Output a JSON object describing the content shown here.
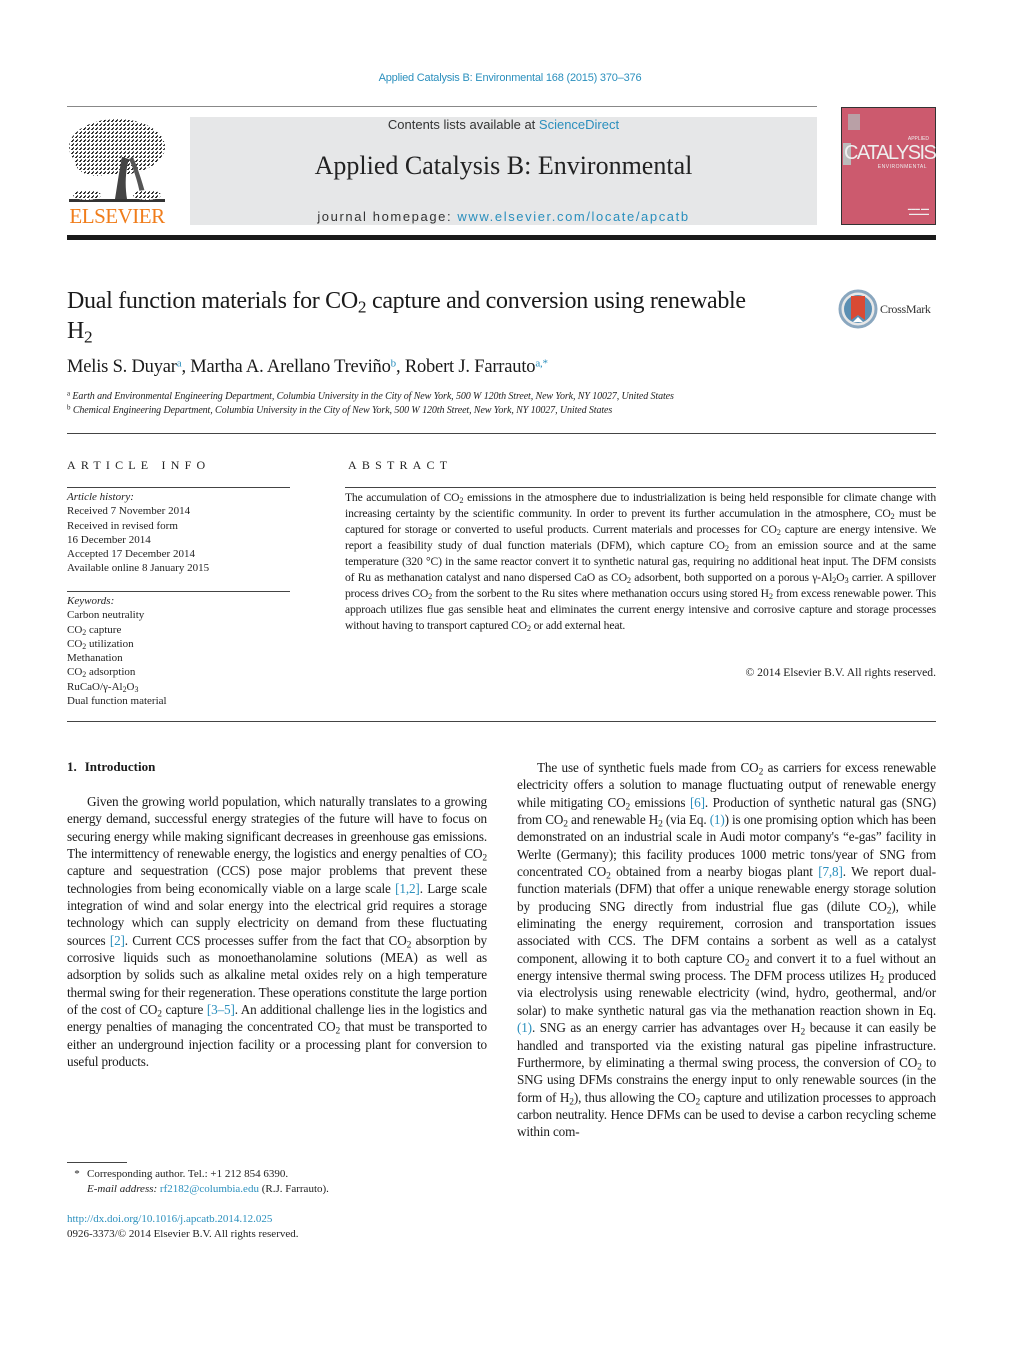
{
  "header": {
    "citation": "Applied Catalysis B: Environmental 168 (2015) 370–376",
    "contents_prefix": "Contents lists available at ",
    "contents_link": "ScienceDirect",
    "journal_title": "Applied Catalysis B: Environmental",
    "homepage_prefix": "journal homepage: ",
    "homepage_link": "www.elsevier.com/locate/apcatb",
    "publisher_logo_text": "ELSEVIER",
    "cover": {
      "title": "CATALYSIS",
      "subtitle_top": "APPLIED",
      "subtitle_bottom": "ENVIRONMENTAL",
      "color": "#cc5a6e"
    }
  },
  "article": {
    "title_part1": "Dual function materials for CO",
    "title_sub1": "2",
    "title_part2": " capture and conversion using renewable H",
    "title_sub2": "2",
    "crossmark_label": "CrossMark",
    "authors": [
      {
        "name": "Melis S. Duyar",
        "affil": "a"
      },
      {
        "name": "Martha A. Arellano Treviño",
        "affil": "b"
      },
      {
        "name": "Robert J. Farrauto",
        "affil": "a,*"
      }
    ],
    "affiliations": [
      {
        "key": "a",
        "text": "Earth and Environmental Engineering Department, Columbia University in the City of New York, 500 W 120th Street, New York, NY 10027, United States"
      },
      {
        "key": "b",
        "text": "Chemical Engineering Department, Columbia University in the City of New York, 500 W 120th Street, New York, NY 10027, United States"
      }
    ]
  },
  "article_info": {
    "heading": "ARTICLE INFO",
    "history_label": "Article history:",
    "history": [
      "Received 7 November 2014",
      "Received in revised form",
      "16 December 2014",
      "Accepted 17 December 2014",
      "Available online 8 January 2015"
    ],
    "keywords_label": "Keywords:",
    "keywords": [
      {
        "pre": "Carbon neutrality",
        "sub": "",
        "post": ""
      },
      {
        "pre": "CO",
        "sub": "2",
        "post": " capture"
      },
      {
        "pre": "CO",
        "sub": "2",
        "post": " utilization"
      },
      {
        "pre": "Methanation",
        "sub": "",
        "post": ""
      },
      {
        "pre": "CO",
        "sub": "2",
        "post": " adsorption"
      },
      {
        "pre": "RuCaO/γ-Al",
        "sub": "2",
        "post": "O",
        "sub2": "3"
      },
      {
        "pre": "Dual function material",
        "sub": "",
        "post": ""
      }
    ]
  },
  "abstract": {
    "heading": "ABSTRACT",
    "segments": [
      {
        "t": "The accumulation of CO"
      },
      {
        "s": "2"
      },
      {
        "t": " emissions in the atmosphere due to industrialization is being held responsible for climate change with increasing certainty by the scientific community. In order to prevent its further accumulation in the atmosphere, CO"
      },
      {
        "s": "2"
      },
      {
        "t": " must be captured for storage or converted to useful products. Current materials and processes for CO"
      },
      {
        "s": "2"
      },
      {
        "t": " capture are energy intensive. We report a feasibility study of dual function materials (DFM), which capture CO"
      },
      {
        "s": "2"
      },
      {
        "t": " from an emission source and at the same temperature (320 °C) in the same reactor convert it to synthetic natural gas, requiring no additional heat input. The DFM consists of Ru as methanation catalyst and nano dispersed CaO as CO"
      },
      {
        "s": "2"
      },
      {
        "t": " adsorbent, both supported on a porous γ-Al"
      },
      {
        "s": "2"
      },
      {
        "t": "O"
      },
      {
        "s": "3"
      },
      {
        "t": " carrier. A spillover process drives CO"
      },
      {
        "s": "2"
      },
      {
        "t": " from the sorbent to the Ru sites where methanation occurs using stored H"
      },
      {
        "s": "2"
      },
      {
        "t": " from excess renewable power. This approach utilizes flue gas sensible heat and eliminates the current energy intensive and corrosive capture and storage processes without having to transport captured CO"
      },
      {
        "s": "2"
      },
      {
        "t": " or add external heat."
      }
    ],
    "copyright": "© 2014 Elsevier B.V. All rights reserved."
  },
  "introduction": {
    "number": "1.",
    "heading": "Introduction",
    "left_paragraph": [
      {
        "t": "Given the growing world population, which naturally translates to a growing energy demand, successful energy strategies of the future will have to focus on securing energy while making significant decreases in greenhouse gas emissions. The intermittency of renewable energy, the logistics and energy penalties of CO"
      },
      {
        "s": "2"
      },
      {
        "t": " capture and sequestration (CCS) pose major problems that prevent these technologies from being economically viable on a large scale "
      },
      {
        "l": "[1,2]"
      },
      {
        "t": ". Large scale integration of wind and solar energy into the electrical grid requires a storage technology which can supply electricity on demand from these fluctuating sources "
      },
      {
        "l": "[2]"
      },
      {
        "t": ". Current CCS processes suffer from the fact that CO"
      },
      {
        "s": "2"
      },
      {
        "t": " absorption by corrosive liquids such as monoethanolamine solutions (MEA) as well as adsorption by solids such as alkaline metal oxides rely on a high temperature thermal swing for their regeneration. These operations constitute the large portion of the cost of CO"
      },
      {
        "s": "2"
      },
      {
        "t": " capture "
      },
      {
        "l": "[3–5]"
      },
      {
        "t": ". An additional challenge lies in the logistics and energy penalties of managing the concentrated CO"
      },
      {
        "s": "2"
      },
      {
        "t": " that must be transported to either an underground injection facility or a processing plant for conversion to useful products."
      }
    ],
    "right_paragraph": [
      {
        "t": "The use of synthetic fuels made from CO"
      },
      {
        "s": "2"
      },
      {
        "t": " as carriers for excess renewable electricity offers a solution to manage fluctuating output of renewable energy while mitigating CO"
      },
      {
        "s": "2"
      },
      {
        "t": " emissions "
      },
      {
        "l": "[6]"
      },
      {
        "t": ". Production of synthetic natural gas (SNG) from CO"
      },
      {
        "s": "2"
      },
      {
        "t": " and renewable H"
      },
      {
        "s": "2"
      },
      {
        "t": " (via Eq. "
      },
      {
        "l": "(1)"
      },
      {
        "t": ") is one promising option which has been demonstrated on an industrial scale in Audi motor company's “e-gas” facility in Werlte (Germany); this facility produces 1000 metric tons/year of SNG from concentrated CO"
      },
      {
        "s": "2"
      },
      {
        "t": " obtained from a nearby biogas plant "
      },
      {
        "l": "[7,8]"
      },
      {
        "t": ". We report dual-function materials (DFM) that offer a unique renewable energy storage solution by producing SNG directly from industrial flue gas (dilute CO"
      },
      {
        "s": "2"
      },
      {
        "t": "), while eliminating the energy requirement, corrosion and transportation issues associated with CCS. The DFM contains a sorbent as well as a catalyst component, allowing it to both capture CO"
      },
      {
        "s": "2"
      },
      {
        "t": " and convert it to a fuel without an energy intensive thermal swing process. The DFM process utilizes H"
      },
      {
        "s": "2"
      },
      {
        "t": " produced via electrolysis using renewable electricity (wind, hydro, geothermal, and/or solar) to make synthetic natural gas via the methanation reaction shown in Eq. "
      },
      {
        "l": "(1)"
      },
      {
        "t": ". SNG as an energy carrier has advantages over H"
      },
      {
        "s": "2"
      },
      {
        "t": " because it can easily be handled and transported via the existing natural gas pipeline infrastructure. Furthermore, by eliminating a thermal swing process, the conversion of CO"
      },
      {
        "s": "2"
      },
      {
        "t": " to SNG using DFMs constrains the energy input to only renewable sources (in the form of H"
      },
      {
        "s": "2"
      },
      {
        "t": "), thus allowing the CO"
      },
      {
        "s": "2"
      },
      {
        "t": " capture and utilization processes to approach carbon neutrality. Hence DFMs can be used to devise a carbon recycling scheme within com-"
      }
    ]
  },
  "footnote": {
    "star": "*",
    "corresponding": "Corresponding author. Tel.: +1 212 854 6390.",
    "email_label": "E-mail address:",
    "email": "rf2182@columbia.edu",
    "email_suffix": " (R.J. Farrauto)."
  },
  "doi": {
    "url": "http://dx.doi.org/10.1016/j.apcatb.2014.12.025",
    "issn_line": "0926-3373/© 2014 Elsevier B.V. All rights reserved."
  },
  "colors": {
    "link": "#2a8fbd",
    "elsevier_orange": "#f07d1b",
    "masthead_gray": "#e6e7e8",
    "cover_pink": "#cc5a6e"
  }
}
